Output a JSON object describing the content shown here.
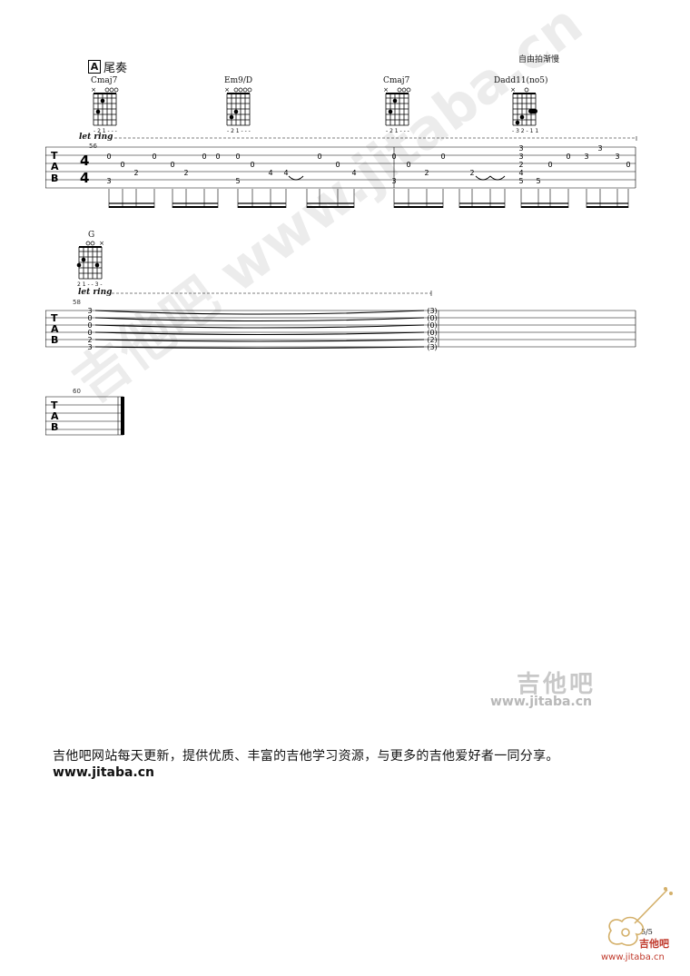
{
  "section": {
    "marker": "A",
    "title": "尾奏",
    "tempo_note": "自由拍渐慢"
  },
  "system1": {
    "measure_number": "56",
    "let_ring": "let ring",
    "chords": [
      {
        "name": "Cmaj7",
        "fingering": "- 2 1 - - -"
      },
      {
        "name": "Em9/D",
        "fingering": "- 2 1 - - -"
      },
      {
        "name": "Cmaj7",
        "fingering": "- 2 1 - - -"
      },
      {
        "name": "Dadd11(no5)",
        "fingering": "- 3 2 - 1 1"
      }
    ]
  },
  "system2": {
    "measure_number": "58",
    "let_ring": "let ring",
    "chords": [
      {
        "name": "G",
        "fingering": "2 1 - - 3 -"
      }
    ]
  },
  "system3": {
    "measure_number": "60"
  },
  "tab_clef": [
    "T",
    "A",
    "B"
  ],
  "time_signature": [
    "4",
    "4"
  ],
  "watermark": "吉他吧 www.jitaba.cn",
  "logo": {
    "name": "吉他吧",
    "url": "www.jitaba.cn"
  },
  "footer": {
    "text": "吉他吧网站每天更新，提供优质、丰富的吉他学习资源，与更多的吉他爱好者一同分享。",
    "url": "www.jitaba.cn"
  },
  "page_number": "5/5",
  "corner_logo": {
    "name": "吉他吧",
    "url": "www.jitaba.cn"
  }
}
